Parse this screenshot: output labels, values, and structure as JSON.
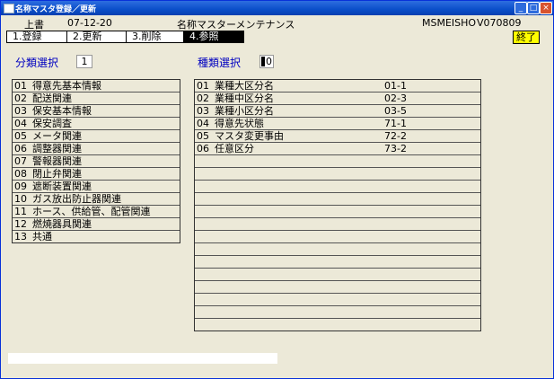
{
  "window": {
    "title": "名称マスタ登録／更新"
  },
  "header": {
    "mode": "上書",
    "date": "07-12-20",
    "screen_title": "名称マスターメンテナンス",
    "program_id": "MSMEISHO",
    "version": "V070809"
  },
  "tabs": [
    {
      "label": "1.登録"
    },
    {
      "label": "2.更新"
    },
    {
      "label": "3.削除"
    },
    {
      "label": "4.参照"
    }
  ],
  "end_button": "終了",
  "category": {
    "label": "分類選択",
    "value": "1"
  },
  "kind": {
    "label": "種類選択",
    "value": "0"
  },
  "categories": [
    {
      "num": "01",
      "name": "得意先基本情報"
    },
    {
      "num": "02",
      "name": "配送関連"
    },
    {
      "num": "03",
      "name": "保安基本情報"
    },
    {
      "num": "04",
      "name": "保安調査"
    },
    {
      "num": "05",
      "name": "メータ関連"
    },
    {
      "num": "06",
      "name": "調整器関連"
    },
    {
      "num": "07",
      "name": "警報器関連"
    },
    {
      "num": "08",
      "name": "閉止弁関連"
    },
    {
      "num": "09",
      "name": "遮断装置関連"
    },
    {
      "num": "10",
      "name": "ガス放出防止器関連"
    },
    {
      "num": "11",
      "name": "ホース、供給管、配管関連"
    },
    {
      "num": "12",
      "name": "燃焼器具関連"
    },
    {
      "num": "13",
      "name": "共通"
    }
  ],
  "kinds": [
    {
      "num": "01",
      "name": "業種大区分名",
      "code": "01-1"
    },
    {
      "num": "02",
      "name": "業種中区分名",
      "code": "02-3"
    },
    {
      "num": "03",
      "name": "業種小区分名",
      "code": "03-5"
    },
    {
      "num": "04",
      "name": "得意先状態",
      "code": "71-1"
    },
    {
      "num": "05",
      "name": "マスタ変更事由",
      "code": "72-2"
    },
    {
      "num": "06",
      "name": "任意区分",
      "code": "73-2"
    },
    {
      "num": "",
      "name": "",
      "code": ""
    },
    {
      "num": "",
      "name": "",
      "code": ""
    },
    {
      "num": "",
      "name": "",
      "code": ""
    },
    {
      "num": "",
      "name": "",
      "code": ""
    },
    {
      "num": "",
      "name": "",
      "code": ""
    },
    {
      "num": "",
      "name": "",
      "code": ""
    },
    {
      "num": "",
      "name": "",
      "code": ""
    },
    {
      "num": "",
      "name": "",
      "code": ""
    },
    {
      "num": "",
      "name": "",
      "code": ""
    },
    {
      "num": "",
      "name": "",
      "code": ""
    },
    {
      "num": "",
      "name": "",
      "code": ""
    },
    {
      "num": "",
      "name": "",
      "code": ""
    },
    {
      "num": "",
      "name": "",
      "code": ""
    },
    {
      "num": "",
      "name": "",
      "code": ""
    }
  ]
}
